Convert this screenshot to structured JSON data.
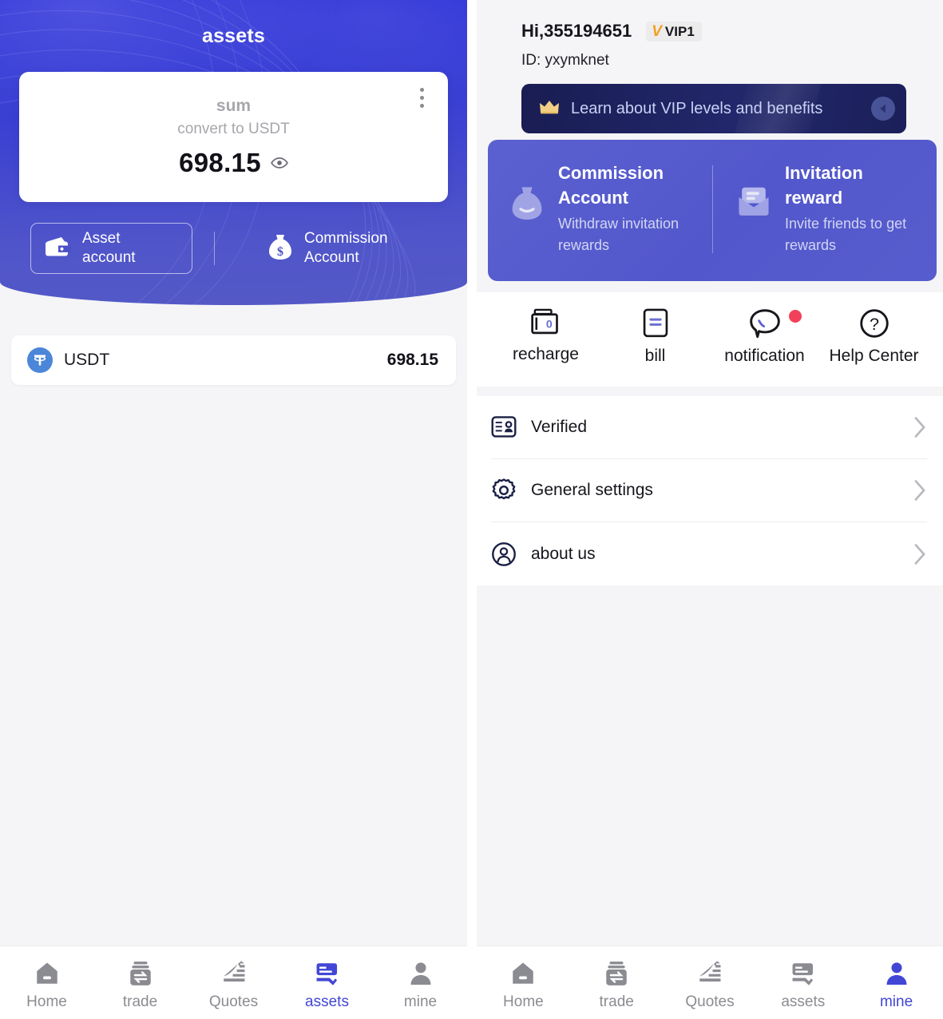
{
  "colors": {
    "hero_blue_top": "#2a2ed8",
    "hero_blue_bottom": "#5459c6",
    "accent_indigo": "#4246d6",
    "promo_card": "#5257cb",
    "vip_banner_navy": "#1b2059",
    "vip_gold": "#f0a020",
    "notify_red": "#f2405a",
    "usdt_logo": "#4b86d8"
  },
  "left_panel": {
    "title": "assets",
    "balance_card": {
      "sum_label": "sum",
      "convert_label": "convert to USDT",
      "amount": "698.15",
      "eye_icon": "eye-icon",
      "menu_icon": "kebab-menu-icon"
    },
    "account_tabs": [
      {
        "label_line1": "Asset",
        "label_line2": "account",
        "icon": "wallet-icon",
        "selected": true
      },
      {
        "label_line1": "Commission",
        "label_line2": "Account",
        "icon": "money-bag-icon",
        "selected": false
      }
    ],
    "tokens": [
      {
        "symbol": "USDT",
        "amount": "698.15",
        "icon": "usdt-icon"
      }
    ]
  },
  "right_panel": {
    "greeting": "Hi,355194651",
    "vip_badge": {
      "mark": "V",
      "level": "VIP1"
    },
    "user_id": "ID: yxymknet",
    "vip_banner": {
      "text": "Learn about VIP levels and benefits",
      "crown_icon": "crown-icon",
      "arrow_icon": "arrow-left-circle-icon"
    },
    "promos": [
      {
        "title_line1": "Commission",
        "title_line2": "Account",
        "desc": "Withdraw invitation rewards",
        "icon": "money-bag-icon"
      },
      {
        "title_line1": "Invitation",
        "title_line2": "reward",
        "desc": "Invite friends to get rewards",
        "icon": "envelope-icon"
      }
    ],
    "quick_actions": [
      {
        "label": "recharge",
        "icon": "recharge-wallet-icon",
        "badge": false
      },
      {
        "label": "bill",
        "icon": "bill-icon",
        "badge": false
      },
      {
        "label": "notification",
        "icon": "chat-bubble-icon",
        "badge": true
      },
      {
        "label": "Help Center",
        "icon": "question-circle-icon",
        "badge": false
      }
    ],
    "settings": [
      {
        "label": "Verified",
        "icon": "id-card-icon"
      },
      {
        "label": "General settings",
        "icon": "gear-icon"
      },
      {
        "label": "about us",
        "icon": "user-circle-icon"
      }
    ]
  },
  "tabbar_left": {
    "items": [
      {
        "label": "Home",
        "icon": "home-icon",
        "active": false
      },
      {
        "label": "trade",
        "icon": "trade-icon",
        "active": false
      },
      {
        "label": "Quotes",
        "icon": "quotes-icon",
        "active": false
      },
      {
        "label": "assets",
        "icon": "assets-icon",
        "active": true
      },
      {
        "label": "mine",
        "icon": "person-icon",
        "active": false
      }
    ]
  },
  "tabbar_right": {
    "items": [
      {
        "label": "Home",
        "icon": "home-icon",
        "active": false
      },
      {
        "label": "trade",
        "icon": "trade-icon",
        "active": false
      },
      {
        "label": "Quotes",
        "icon": "quotes-icon",
        "active": false
      },
      {
        "label": "assets",
        "icon": "assets-icon",
        "active": false
      },
      {
        "label": "mine",
        "icon": "person-icon",
        "active": true
      }
    ]
  }
}
